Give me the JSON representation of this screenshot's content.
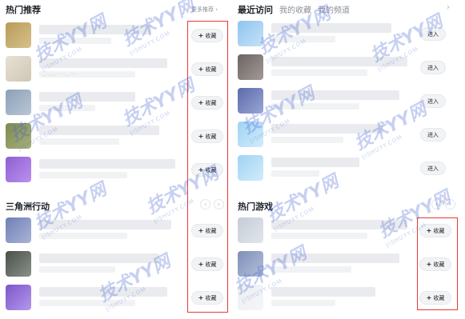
{
  "left": {
    "hot_title": "热门推荐",
    "more_label": "更多推荐",
    "hot_items": [
      {
        "thumb_colors": [
          "#b89a58",
          "#d7c28b"
        ],
        "sub_note": "",
        "collect_label": "收藏"
      },
      {
        "thumb_colors": [
          "#e7e1d3",
          "#cfc7b4"
        ],
        "sub_note": ".. ·..·.. ·· ··.. · ··",
        "collect_label": "收藏"
      },
      {
        "thumb_colors": [
          "#8ba0b8",
          "#b9c7d6"
        ],
        "sub_note": "",
        "collect_label": "收藏"
      },
      {
        "thumb_colors": [
          "#7f8a53",
          "#a6b17a"
        ],
        "sub_note": "..",
        "collect_label": "收藏"
      },
      {
        "thumb_colors": [
          "#8e5fd1",
          "#b991ef"
        ],
        "sub_note": "",
        "collect_label": "收藏"
      }
    ],
    "delta_title": "三角洲行动",
    "delta_items": [
      {
        "thumb_colors": [
          "#6f7fb4",
          "#aab4d8"
        ],
        "collect_label": "收藏"
      },
      {
        "thumb_colors": [
          "#4a4f4a",
          "#8a918a"
        ],
        "collect_label": "收藏"
      },
      {
        "thumb_colors": [
          "#7c56c9",
          "#b398ec"
        ],
        "collect_label": "收藏"
      }
    ]
  },
  "right": {
    "tabs": [
      "最近访问",
      "我的收藏",
      "我的频道"
    ],
    "recent_items": [
      {
        "thumb_colors": [
          "#8fc4ef",
          "#c6e2f8"
        ],
        "enter_label": "进入"
      },
      {
        "thumb_colors": [
          "#6b6462",
          "#a39a97"
        ],
        "enter_label": "进入"
      },
      {
        "thumb_colors": [
          "#5b6aa8",
          "#9aa6d6"
        ],
        "enter_label": "进入"
      },
      {
        "thumb_colors": [
          "#9fd3f4",
          "#d2ecfb"
        ],
        "enter_label": "进入"
      },
      {
        "thumb_colors": [
          "#9fd3f4",
          "#d2ecfb"
        ],
        "enter_label": "进入"
      }
    ],
    "games_title": "热门游戏",
    "game_items": [
      {
        "thumb_colors": [
          "#c4ccd6",
          "#e2e6eb"
        ],
        "collect_label": "收藏"
      },
      {
        "thumb_colors": [
          "#7d8fb7",
          "#b5c1dc"
        ],
        "collect_label": "收藏"
      },
      {
        "thumb_colors": [
          "#eceef1",
          "#f5f6f8"
        ],
        "collect_label": "收藏"
      }
    ]
  },
  "watermark": {
    "brand": "技术YY网",
    "site": "JISHUYY.COM"
  },
  "colors": {
    "highlight": "#e53935",
    "button_bg": "#f2f3f5",
    "title": "#1f2329"
  }
}
